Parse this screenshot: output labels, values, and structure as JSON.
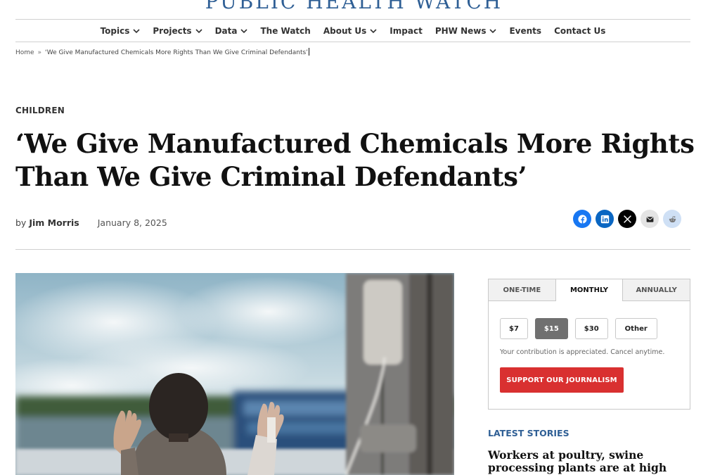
{
  "site": {
    "logo_text": "PUBLIC HEALTH WATCH"
  },
  "nav": {
    "items": [
      {
        "label": "Topics",
        "has_dropdown": true
      },
      {
        "label": "Projects",
        "has_dropdown": true
      },
      {
        "label": "Data",
        "has_dropdown": true
      },
      {
        "label": "The Watch",
        "has_dropdown": false
      },
      {
        "label": "About Us",
        "has_dropdown": true
      },
      {
        "label": "Impact",
        "has_dropdown": false
      },
      {
        "label": "PHW News",
        "has_dropdown": true
      },
      {
        "label": "Events",
        "has_dropdown": false
      },
      {
        "label": "Contact Us",
        "has_dropdown": false
      }
    ]
  },
  "breadcrumb": {
    "home": "Home",
    "separator": "»",
    "current": "‘We Give Manufactured Chemicals More Rights Than We Give Criminal Defendants’"
  },
  "article": {
    "category": "CHILDREN",
    "title": "‘We Give Manufactured Chemicals More Rights Than We Give Criminal Defendants’",
    "by": "by",
    "author": "Jim Morris",
    "date": "January 8, 2025"
  },
  "share": {
    "icons": [
      "facebook-icon",
      "linkedin-icon",
      "x-icon",
      "email-icon",
      "reddit-icon"
    ]
  },
  "donate": {
    "tabs": [
      "ONE-TIME",
      "MONTHLY",
      "ANNUALLY"
    ],
    "active_tab": "MONTHLY",
    "amounts": [
      "$7",
      "$15",
      "$30",
      "Other"
    ],
    "selected_amount": "$15",
    "note": "Your contribution is appreciated. Cancel anytime.",
    "button_label": "SUPPORT OUR JOURNALISM"
  },
  "sidebar": {
    "latest_heading": "LATEST STORIES",
    "first_story": "Workers at poultry, swine processing plants are at high risk"
  },
  "colors": {
    "brand_blue": "#2f5f95",
    "cta_red": "#d93030",
    "selected_gray": "#707070"
  }
}
